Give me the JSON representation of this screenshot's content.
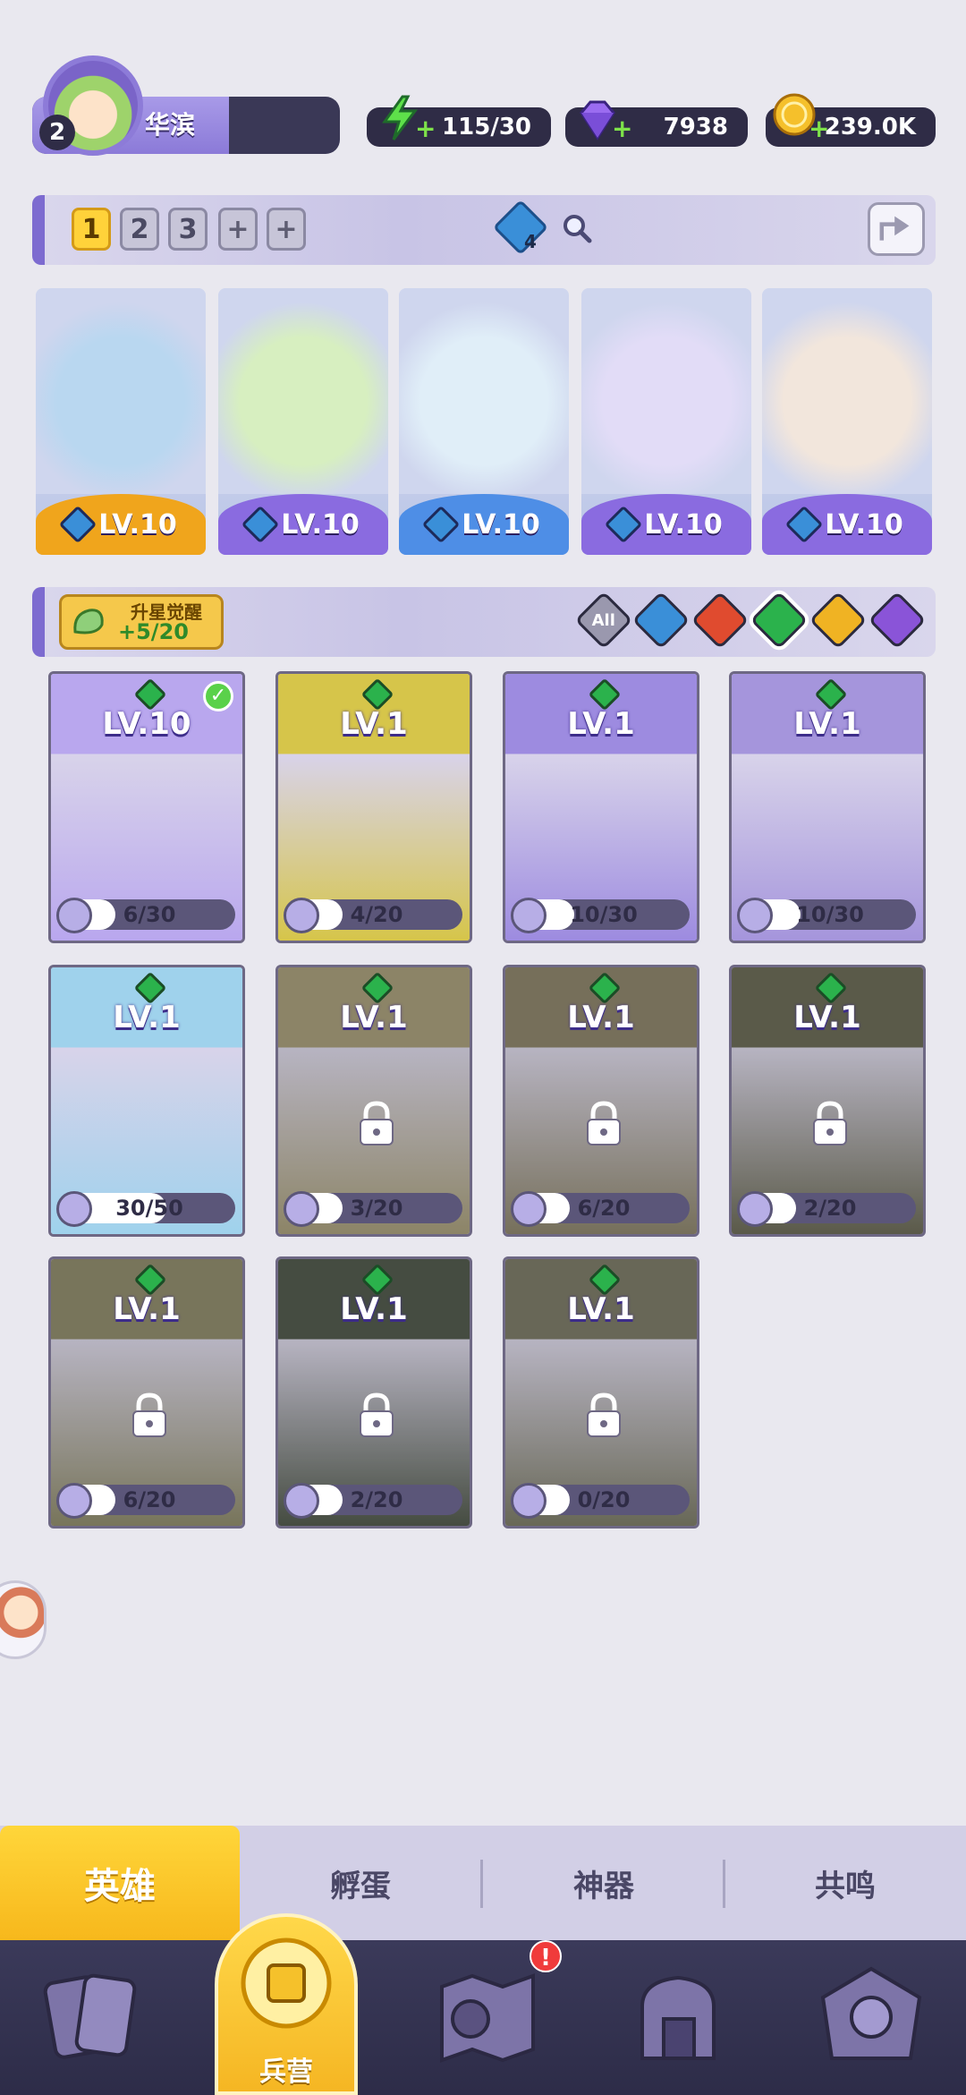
{
  "profile": {
    "name": "华滨",
    "level": "2"
  },
  "resources": {
    "energy": {
      "icon": "lightning-icon",
      "value": "115/30",
      "color": "#5ee04a"
    },
    "gems": {
      "icon": "diamond-icon",
      "value": "7938",
      "color": "#9b6cf0"
    },
    "gold": {
      "icon": "coin-icon",
      "value": "239.0K",
      "color": "#f5c02b"
    }
  },
  "team": {
    "slots": [
      "1",
      "2",
      "3",
      "+",
      "+"
    ],
    "active_slot": "1",
    "element_count": "4"
  },
  "lineup": [
    {
      "level": "LV.10",
      "band": "#f0a51c",
      "art": "#b9d7f0"
    },
    {
      "level": "LV.10",
      "band": "#8a6be0",
      "art": "#d7efc0"
    },
    {
      "level": "LV.10",
      "band": "#4e8ee6",
      "art": "#e0eef8"
    },
    {
      "level": "LV.10",
      "band": "#8a6be0",
      "art": "#e2dcf7"
    },
    {
      "level": "LV.10",
      "band": "#8a6be0",
      "art": "#f2e6dc"
    }
  ],
  "upgrade": {
    "label": "升星觉醒",
    "sub": "+5/20"
  },
  "filters": [
    {
      "label": "All",
      "color": "#9a98ae"
    },
    {
      "label": "",
      "color": "#3a8fd8"
    },
    {
      "label": "",
      "color": "#e04b2f"
    },
    {
      "label": "",
      "color": "#2bb24c"
    },
    {
      "label": "",
      "color": "#f0b323"
    },
    {
      "label": "",
      "color": "#8a54d8"
    }
  ],
  "heroes": [
    {
      "level": "LV.10",
      "progress": "6/30",
      "fill": 0.2,
      "locked": false,
      "owned": true,
      "checked": true,
      "bg": "#b9a7ee"
    },
    {
      "level": "LV.1",
      "progress": "4/20",
      "fill": 0.2,
      "locked": false,
      "owned": true,
      "checked": false,
      "bg": "#d6c54a"
    },
    {
      "level": "LV.1",
      "progress": "10/30",
      "fill": 0.33,
      "locked": false,
      "owned": true,
      "checked": false,
      "bg": "#9d8be0"
    },
    {
      "level": "LV.1",
      "progress": "10/30",
      "fill": 0.33,
      "locked": false,
      "owned": true,
      "checked": false,
      "bg": "#a595dc"
    },
    {
      "level": "LV.1",
      "progress": "30/50",
      "fill": 0.6,
      "locked": false,
      "owned": true,
      "checked": false,
      "bg": "#9fd2ec"
    },
    {
      "level": "LV.1",
      "progress": "3/20",
      "fill": 0.15,
      "locked": true,
      "owned": false,
      "checked": false,
      "bg": "#a99c6a"
    },
    {
      "level": "LV.1",
      "progress": "6/20",
      "fill": 0.3,
      "locked": true,
      "owned": false,
      "checked": false,
      "bg": "#8e8360"
    },
    {
      "level": "LV.1",
      "progress": "2/20",
      "fill": 0.1,
      "locked": true,
      "owned": false,
      "checked": false,
      "bg": "#6b6a4e"
    },
    {
      "level": "LV.1",
      "progress": "6/20",
      "fill": 0.3,
      "locked": true,
      "owned": false,
      "checked": false,
      "bg": "#8f8a5e"
    },
    {
      "level": "LV.1",
      "progress": "2/20",
      "fill": 0.1,
      "locked": true,
      "owned": false,
      "checked": false,
      "bg": "#4f5a48"
    },
    {
      "level": "LV.1",
      "progress": "0/20",
      "fill": 0.0,
      "locked": true,
      "owned": false,
      "checked": false,
      "bg": "#7b7a5e"
    }
  ],
  "sub_tabs": [
    "英雄",
    "孵蛋",
    "神器",
    "共鸣"
  ],
  "nav": {
    "active_label": "兵营",
    "items": [
      "cards-icon",
      "barracks-icon",
      "map-icon",
      "shop-icon",
      "guild-icon"
    ],
    "notification": "!"
  }
}
